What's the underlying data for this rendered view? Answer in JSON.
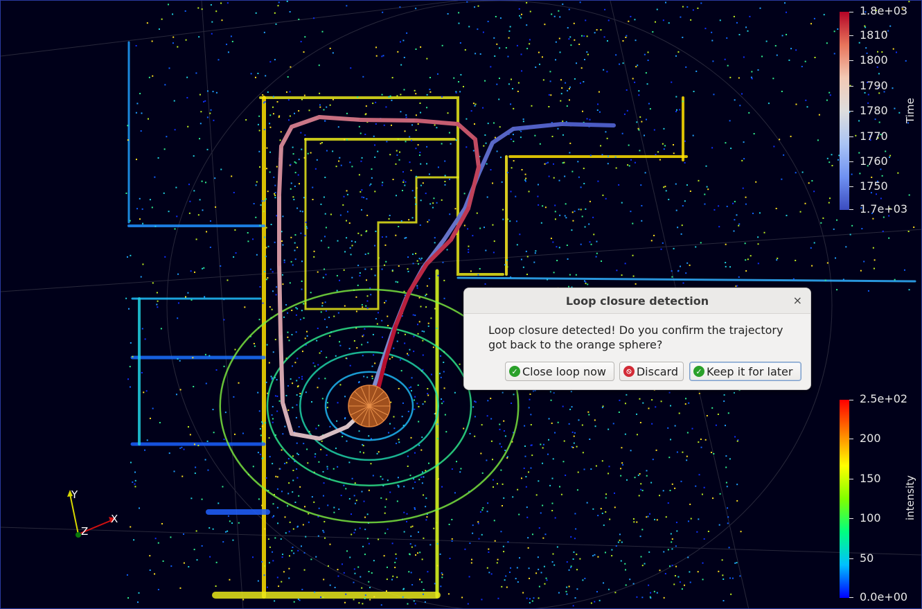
{
  "viewer": {
    "colors": {
      "background": "#000019",
      "trajectory_start": "#b40426",
      "trajectory_end": "#3b4cc0",
      "sphere": "#c86428"
    }
  },
  "time_colorbar": {
    "title": "Time",
    "ticks": [
      "1.8e+03",
      "1810",
      "1800",
      "1790",
      "1780",
      "1770",
      "1760",
      "1750",
      "1.7e+03"
    ]
  },
  "intensity_colorbar": {
    "title": "intensity",
    "ticks": [
      "2.5e+02",
      "200",
      "150",
      "100",
      "50",
      "0.0e+00"
    ]
  },
  "axes": {
    "x": "X",
    "y": "Y",
    "z": "Z"
  },
  "dialog": {
    "title": "Loop closure detection",
    "close_glyph": "×",
    "message": "Loop closure detected! Do you confirm the trajectory got back to the orange sphere?",
    "buttons": {
      "close_loop": "Close loop now",
      "discard": "Discard",
      "keep_later": "Keep it for later"
    }
  }
}
